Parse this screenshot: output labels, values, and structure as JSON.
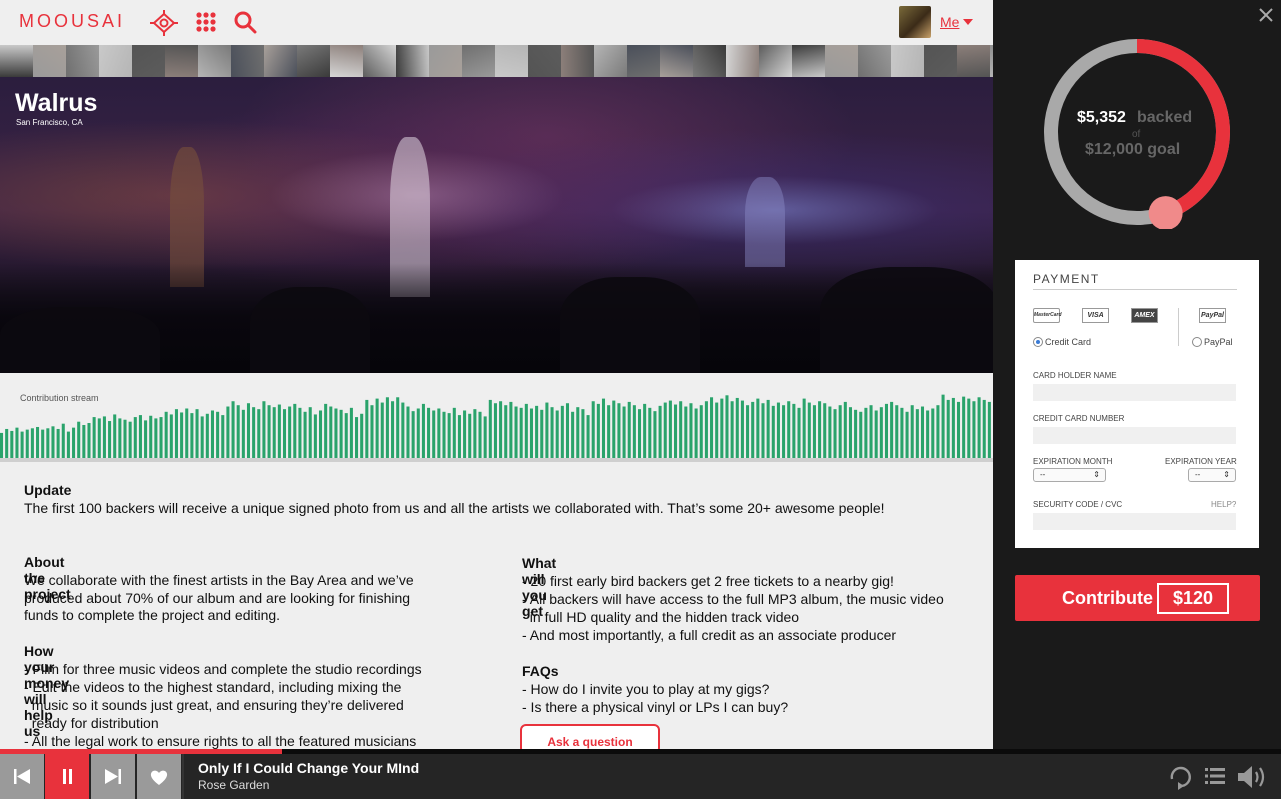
{
  "header": {
    "logo": "MOOUSAI",
    "user_label": "Me"
  },
  "project": {
    "name": "Walrus",
    "location": "San Francisco, CA",
    "stream_label": "Contribution stream",
    "stream_values": [
      0.38,
      0.44,
      0.41,
      0.46,
      0.4,
      0.43,
      0.45,
      0.47,
      0.43,
      0.45,
      0.48,
      0.44,
      0.52,
      0.4,
      0.46,
      0.55,
      0.5,
      0.53,
      0.62,
      0.6,
      0.63,
      0.56,
      0.66,
      0.6,
      0.58,
      0.55,
      0.62,
      0.65,
      0.57,
      0.64,
      0.6,
      0.62,
      0.7,
      0.66,
      0.74,
      0.69,
      0.75,
      0.68,
      0.74,
      0.63,
      0.67,
      0.72,
      0.7,
      0.65,
      0.78,
      0.86,
      0.8,
      0.73,
      0.83,
      0.77,
      0.74,
      0.86,
      0.8,
      0.77,
      0.81,
      0.74,
      0.78,
      0.82,
      0.76,
      0.7,
      0.77,
      0.66,
      0.72,
      0.82,
      0.78,
      0.75,
      0.73,
      0.68,
      0.76,
      0.62,
      0.67,
      0.88,
      0.8,
      0.9,
      0.84,
      0.92,
      0.86,
      0.92,
      0.84,
      0.78,
      0.71,
      0.75,
      0.82,
      0.76,
      0.72,
      0.75,
      0.7,
      0.68,
      0.76,
      0.65,
      0.72,
      0.67,
      0.74,
      0.7,
      0.63,
      0.88,
      0.83,
      0.86,
      0.8,
      0.85,
      0.78,
      0.76,
      0.82,
      0.75,
      0.79,
      0.73,
      0.84,
      0.77,
      0.72,
      0.79,
      0.83,
      0.7,
      0.77,
      0.74,
      0.65,
      0.86,
      0.82,
      0.9,
      0.8,
      0.87,
      0.83,
      0.78,
      0.85,
      0.8,
      0.74,
      0.82,
      0.76,
      0.71,
      0.79,
      0.84,
      0.87,
      0.81,
      0.86,
      0.78,
      0.83,
      0.75,
      0.8,
      0.86,
      0.92,
      0.84,
      0.9,
      0.95,
      0.86,
      0.91,
      0.87,
      0.8,
      0.85,
      0.9,
      0.83,
      0.88,
      0.79,
      0.84,
      0.8,
      0.86,
      0.82,
      0.76,
      0.9,
      0.84,
      0.8,
      0.86,
      0.83,
      0.78,
      0.74,
      0.8,
      0.85,
      0.77,
      0.73,
      0.7,
      0.76,
      0.8,
      0.72,
      0.77,
      0.82,
      0.85,
      0.8,
      0.76,
      0.7,
      0.8,
      0.74,
      0.78,
      0.72,
      0.75,
      0.8,
      0.96,
      0.88,
      0.91,
      0.85,
      0.93,
      0.9,
      0.86,
      0.92,
      0.88,
      0.85
    ]
  },
  "sections": {
    "update_title": "Update",
    "update_text": "The first 100 backers will receive a unique signed photo from us and all the artists we collaborated with. That’s some 20+ awesome people!",
    "about_title": "About the project",
    "about_lines": [
      "We collaborate with the finest artists in the Bay Area and we’ve",
      "produced about 70% of our album and are looking for finishing",
      "funds to complete the project and editing."
    ],
    "money_title": "How your money will help us",
    "money_lines": [
      "- Film for three music videos and complete the studio recordings",
      "- Edit the videos to the highest standard, including mixing the",
      "  music so it sounds just great, and ensuring they’re delivered",
      "  ready for distribution",
      "- All the legal work to ensure rights to all the featured musicians"
    ],
    "get_title": "What will you get",
    "get_lines": [
      "- 20 first early bird backers get 2 free tickets to a nearby gig!",
      "- All backers will have access to the full MP3 album, the music video",
      "  in full HD quality and the hidden track video",
      "- And most importantly, a full credit as an associate producer"
    ],
    "faq_title": "FAQs",
    "faq_lines": [
      "- How do I invite you to play at my gigs?",
      "- Is there a physical vinyl or LPs I can buy?"
    ],
    "ask_label": "Ask a question"
  },
  "funding": {
    "backed_amount": "$5,352",
    "backed_word": "backed",
    "of_word": "of",
    "goal_text": "$12,000 goal",
    "backed_value": 5352,
    "goal_value": 12000,
    "accent": "#e8323c"
  },
  "payment": {
    "title": "PAYMENT",
    "cards": [
      "MasterCard",
      "VISA",
      "AMEX",
      "PayPal"
    ],
    "credit_card_label": "Credit Card",
    "paypal_label": "PayPal",
    "selected": "Credit Card",
    "holder_label": "CARD HOLDER NAME",
    "number_label": "CREDIT CARD NUMBER",
    "month_label": "EXPIRATION MONTH",
    "year_label": "EXPIRATION YEAR",
    "month_value": "--",
    "year_value": "--",
    "cvc_label": "SECURITY CODE / CVC",
    "help_label": "HELP?"
  },
  "contribute": {
    "label": "Contribute",
    "amount": "$120"
  },
  "player": {
    "track_title": "Only If I Could Change Your MInd",
    "artist": "Rose Garden",
    "progress": 0.22
  }
}
